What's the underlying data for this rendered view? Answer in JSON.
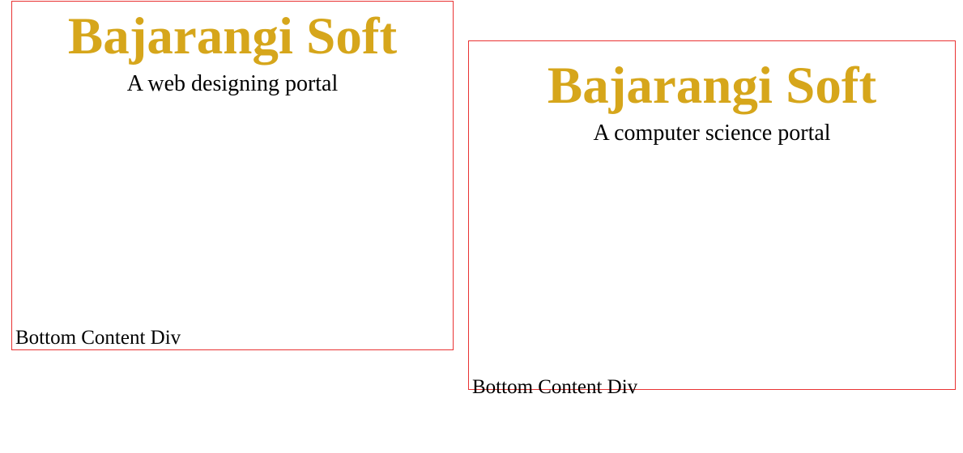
{
  "left_box": {
    "title": "Bajarangi Soft",
    "subtitle": "A web designing portal",
    "bottom_label": "Bottom Content Div"
  },
  "right_box": {
    "title": "Bajarangi Soft",
    "subtitle": "A computer science portal",
    "bottom_label": "Bottom Content Div"
  }
}
